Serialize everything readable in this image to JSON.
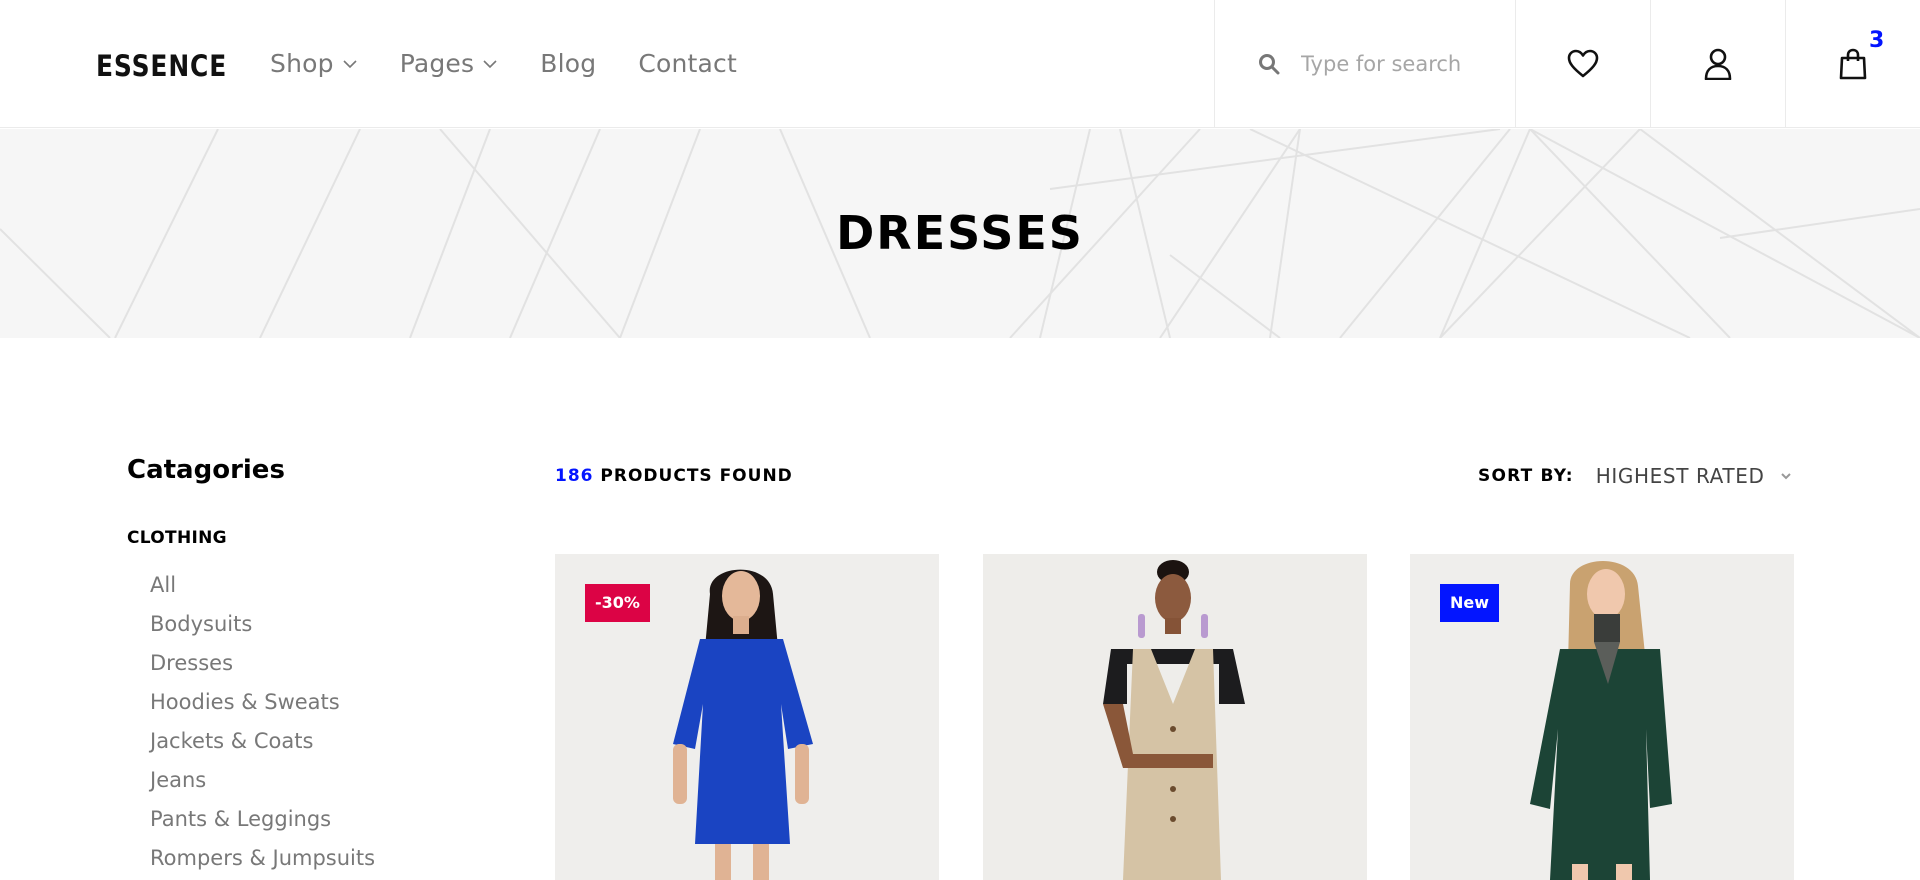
{
  "brand": {
    "logo_text": "ESSENCE"
  },
  "nav": [
    {
      "label": "Shop",
      "has_dropdown": true
    },
    {
      "label": "Pages",
      "has_dropdown": true
    },
    {
      "label": "Blog",
      "has_dropdown": false
    },
    {
      "label": "Contact",
      "has_dropdown": false
    }
  ],
  "search": {
    "placeholder": "Type for search",
    "icon": "search-icon"
  },
  "header_icons": {
    "wishlist": "heart-icon",
    "account": "user-icon",
    "cart": "shopping-bag-icon",
    "cart_count": "3"
  },
  "banner": {
    "title": "DRESSES"
  },
  "sidebar": {
    "title": "Catagories",
    "section": "CLOTHING",
    "items": [
      "All",
      "Bodysuits",
      "Dresses",
      "Hoodies & Sweats",
      "Jackets & Coats",
      "Jeans",
      "Pants & Leggings",
      "Rompers & Jumpsuits"
    ]
  },
  "results": {
    "count": "186",
    "label": "PRODUCTS FOUND"
  },
  "sort": {
    "label": "SORT BY:",
    "value": "HIGHEST RATED"
  },
  "products": [
    {
      "badge": "-30%",
      "badge_type": "sale",
      "dress_color": "#1a44c2"
    },
    {
      "badge": "",
      "badge_type": "none",
      "dress_color": "#d5c3a5"
    },
    {
      "badge": "New",
      "badge_type": "new",
      "dress_color": "#1c4436"
    }
  ],
  "colors": {
    "accent_blue": "#0315ff",
    "sale_red": "#dc0345",
    "nav_gray": "#787878"
  }
}
